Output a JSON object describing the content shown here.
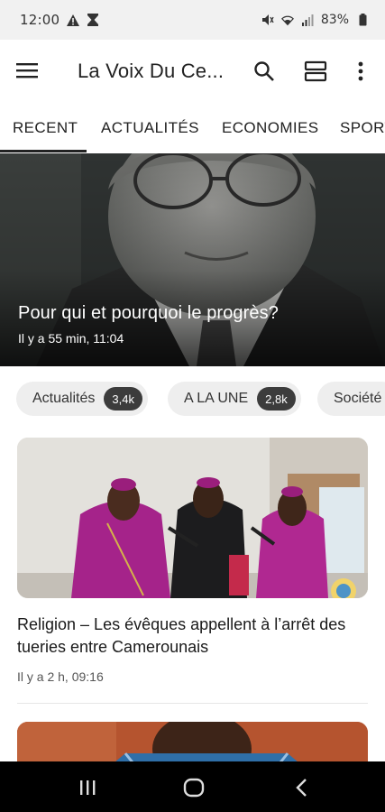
{
  "status": {
    "time": "12:00",
    "battery": "83%",
    "icons": [
      "warning-icon",
      "hourglass-icon",
      "mute-icon",
      "wifi-icon",
      "signal-icon",
      "battery-icon"
    ]
  },
  "appbar": {
    "title": "La Voix Du Ce...",
    "icons": [
      "menu-icon",
      "search-icon",
      "layout-toggle-icon",
      "more-vert-icon"
    ]
  },
  "tabs": [
    {
      "label": "RECENT",
      "active": true
    },
    {
      "label": "ACTUALITÉS",
      "active": false
    },
    {
      "label": "ECONOMIES",
      "active": false
    },
    {
      "label": "SPORT",
      "active": false
    }
  ],
  "hero": {
    "title": "Pour qui et pourquoi le progrès?",
    "meta": "Il y a 55 min, 11:04"
  },
  "chips": [
    {
      "label": "Actualités",
      "count": "3,4k"
    },
    {
      "label": "A LA UNE",
      "count": "2,8k"
    },
    {
      "label": "Société",
      "count": ""
    }
  ],
  "article": {
    "title": "Religion – Les évêques appellent à l’arrêt des tueries entre Camerounais",
    "meta": "Il y a 2 h, 09:16"
  },
  "navbar": {
    "icons": [
      "recent-apps-icon",
      "home-icon",
      "back-icon"
    ]
  },
  "colors": {
    "status_bg": "#f1f1f1",
    "chip_bg": "#eeeeee",
    "chip_count_bg": "#3c3c3c",
    "nav_bg": "#000000"
  }
}
